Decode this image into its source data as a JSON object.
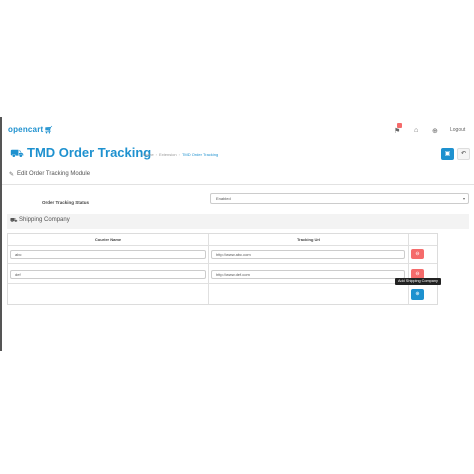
{
  "nav": {
    "logo": "opencart",
    "logout_label": "Logout"
  },
  "header": {
    "title": "TMD Order Tracking",
    "breadcrumb": [
      "Home",
      "Extension",
      "TMD Order Tracking"
    ]
  },
  "panel": {
    "title": "Edit Order Tracking Module"
  },
  "form": {
    "status_label": "Order Tracking Status",
    "status_value": "Enabled"
  },
  "shipping": {
    "title": "Shipping Company",
    "columns": [
      "Courier Name",
      "Tracking Url"
    ],
    "rows": [
      {
        "courier": "abc",
        "url": "http://www.abc.com"
      },
      {
        "courier": "def",
        "url": "http://www.def.com"
      }
    ],
    "add_tooltip": "Add Shipping Company"
  },
  "colors": {
    "accent": "#1e91cf",
    "danger": "#f56b6b"
  },
  "icons": [
    "cart-icon",
    "bell-icon",
    "home-icon",
    "help-icon",
    "truck-icon",
    "save-icon",
    "back-icon",
    "pencil-icon",
    "car-icon",
    "minus-circle-icon",
    "plus-circle-icon"
  ]
}
